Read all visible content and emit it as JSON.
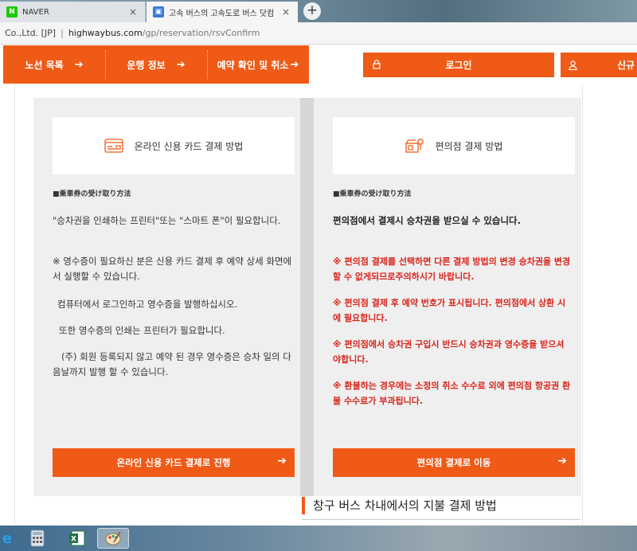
{
  "browser": {
    "tabs": [
      {
        "favicon": "N",
        "title": "NAVER",
        "active": false
      },
      {
        "favicon": "▣",
        "title": "고속 버스의 고속도로 버스 닷컴",
        "active": true
      }
    ],
    "new_tab_icon": "+",
    "close_icon": "×",
    "address": {
      "security": "Co.,Ltd. [JP]",
      "host": "highwaybus.com",
      "path": "/gp/reservation/rsvConfirm"
    }
  },
  "nav": {
    "items": [
      {
        "label": "노선 목록"
      },
      {
        "label": "운행 정보"
      },
      {
        "label": "예약 확인 및 취소"
      }
    ],
    "arrow": "➔",
    "login_label": "로그인",
    "signup_label": "신규"
  },
  "left_panel": {
    "card_title": "온라인 신용 카드 결제 방법",
    "subhead": "■乗車券の受け取り方法",
    "paragraphs": [
      "\"승차권을 인쇄하는 프린터\"또는 \"스마트 폰\"이 필요합니다.",
      "※ 영수증이 필요하신 분은 신용 카드 결제 후 예약 상세 화면에서 실행할 수 있습니다.",
      "컴퓨터에서 로그인하고 영수증을 발행하십시오.",
      "또한 영수증의 인쇄는 프린터가 필요합니다.",
      "(주) 회원 등록되지 않고 예약 된 경우 영수증은 승차 일의 다음날까지 발행 할 수 있습니다."
    ],
    "button_label": "온라인 신용 카드 결제로 진행"
  },
  "right_panel": {
    "card_title": "편의점 결제 방법",
    "subhead": "■乗車券の受け取り方法",
    "lead": "편의점에서 결제시 승차권을 받으실 수 있습니다.",
    "warnings": [
      "※ 편의점 결제를 선택하면 다른 결제 방법의 변경 승차권을 변경할 수 없게되므로주의하시기 바랍니다.",
      "※ 편의점 결제 후 예약 번호가 표시됩니다. 편의점에서 상환 시에 필요합니다.",
      "※ 편의점에서 승차권 구입시 반드시 승차권과 영수증을 받으셔야합니다.",
      "※ 환불하는 경우에는 소정의 취소 수수료 외에 편의점 항공권 환불 수수료가 부과됩니다."
    ],
    "button_label": "편의점 결제로 이동"
  },
  "section": {
    "title": "창구 버스 차내에서의 지불 결제 방법"
  },
  "colors": {
    "accent": "#ef5a16",
    "warning": "#d8261c",
    "panel_bg": "#efefef"
  },
  "taskbar": {
    "icons": [
      "ie-icon",
      "calculator-icon",
      "excel-icon",
      "paint-icon"
    ]
  }
}
